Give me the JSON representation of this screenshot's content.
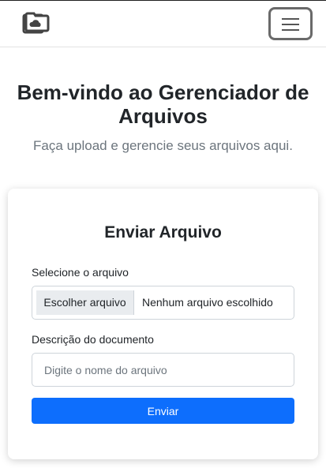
{
  "navbar": {
    "brand_icon": "folder-stack-cloud-icon",
    "toggler_icon": "hamburger-menu-icon"
  },
  "hero": {
    "title": "Bem-vindo ao Gerenciador de Arquivos",
    "subtitle": "Faça upload e gerencie seus arquivos aqui."
  },
  "upload_card": {
    "title": "Enviar Arquivo",
    "file_label": "Selecione o arquivo",
    "file_button": "Escolher arquivo",
    "file_status": "Nenhum arquivo escolhido",
    "description_label": "Descrição do documento",
    "description_placeholder": "Digite o nome do arquivo",
    "description_value": "",
    "submit_label": "Enviar"
  },
  "colors": {
    "primary": "#0d6efd",
    "muted": "#6c757d",
    "text": "#212529"
  }
}
